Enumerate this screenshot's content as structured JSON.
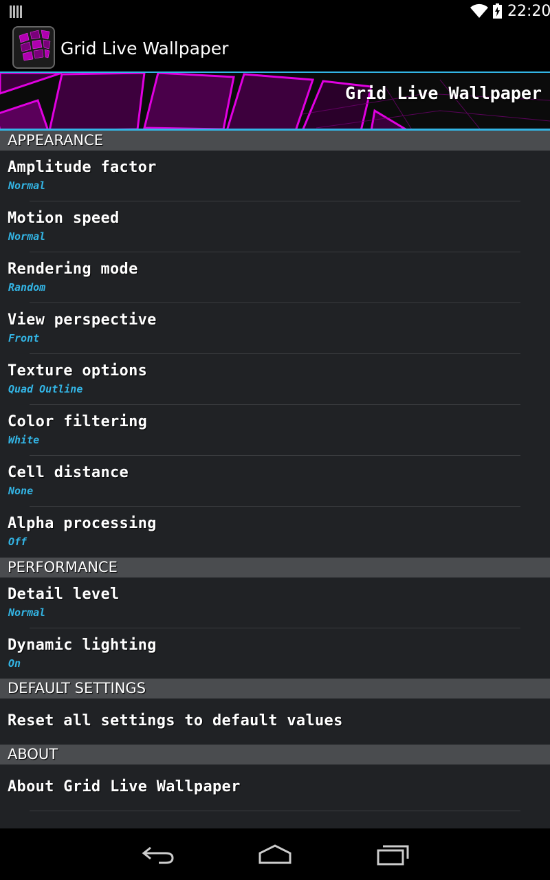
{
  "status_bar": {
    "time": "22:20",
    "icons": [
      "barcode-icon",
      "wifi-icon",
      "battery-charging-icon"
    ]
  },
  "action_bar": {
    "title": "Grid Live Wallpaper",
    "icon": "app-icon"
  },
  "banner": {
    "title": "Grid Live Wallpaper"
  },
  "sections": {
    "appearance": {
      "header": "APPEARANCE",
      "items": [
        {
          "title": "Amplitude factor",
          "summary": "Normal"
        },
        {
          "title": "Motion speed",
          "summary": "Normal"
        },
        {
          "title": "Rendering mode",
          "summary": "Random"
        },
        {
          "title": "View perspective",
          "summary": "Front"
        },
        {
          "title": "Texture options",
          "summary": "Quad Outline"
        },
        {
          "title": "Color filtering",
          "summary": "White"
        },
        {
          "title": "Cell distance",
          "summary": "None"
        },
        {
          "title": "Alpha processing",
          "summary": "Off"
        }
      ]
    },
    "performance": {
      "header": "PERFORMANCE",
      "items": [
        {
          "title": "Detail level",
          "summary": "Normal"
        },
        {
          "title": "Dynamic lighting",
          "summary": "On"
        }
      ]
    },
    "default_settings": {
      "header": "DEFAULT SETTINGS",
      "items": [
        {
          "title": "Reset all settings to default values"
        }
      ]
    },
    "about": {
      "header": "ABOUT",
      "items": [
        {
          "title": "About Grid Live Wallpaper"
        }
      ]
    }
  },
  "nav_bar": {
    "icons": [
      "back-icon",
      "home-icon",
      "recents-icon"
    ]
  },
  "colors": {
    "accent": "#33b5e5",
    "banner_magenta": "#c000c0",
    "list_bg": "#202225",
    "section_bg": "#4a4c4f"
  }
}
